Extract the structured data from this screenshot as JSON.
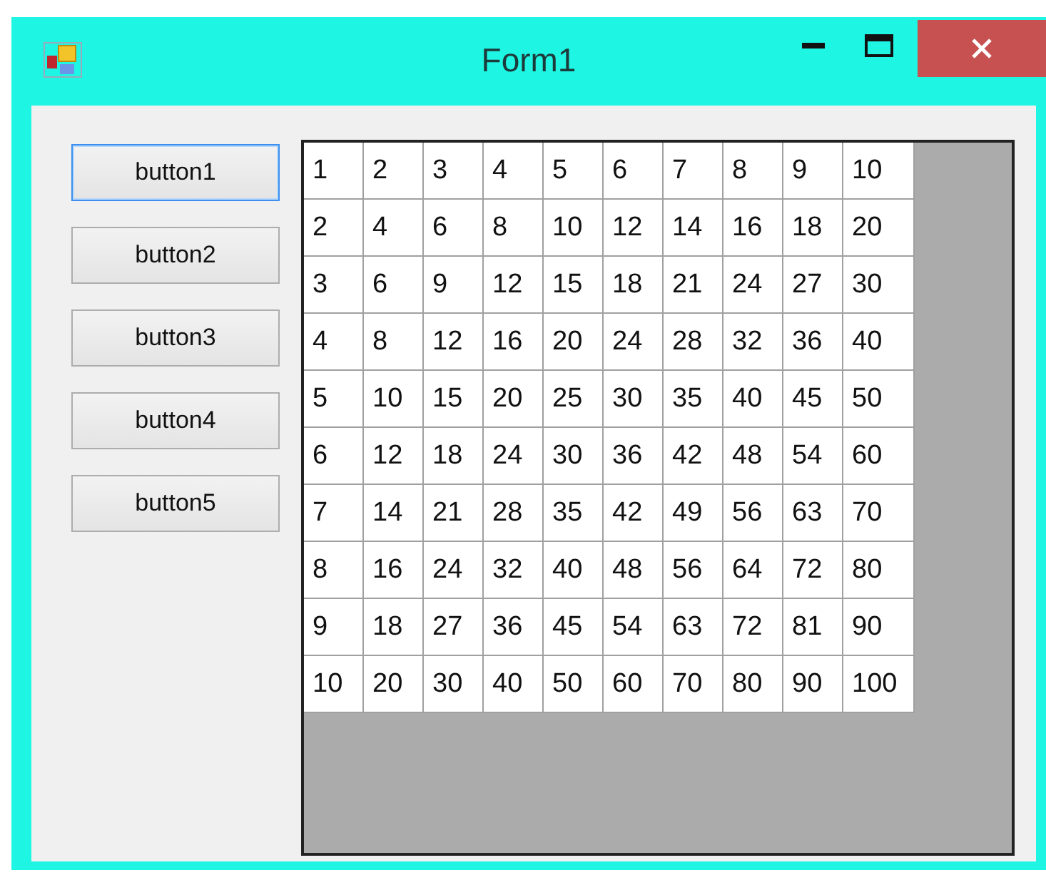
{
  "window": {
    "title": "Form1"
  },
  "buttons": [
    {
      "label": "button1",
      "focused": true
    },
    {
      "label": "button2",
      "focused": false
    },
    {
      "label": "button3",
      "focused": false
    },
    {
      "label": "button4",
      "focused": false
    },
    {
      "label": "button5",
      "focused": false
    }
  ],
  "table": {
    "rows": [
      [
        "1",
        "2",
        "3",
        "4",
        "5",
        "6",
        "7",
        "8",
        "9",
        "10"
      ],
      [
        "2",
        "4",
        "6",
        "8",
        "10",
        "12",
        "14",
        "16",
        "18",
        "20"
      ],
      [
        "3",
        "6",
        "9",
        "12",
        "15",
        "18",
        "21",
        "24",
        "27",
        "30"
      ],
      [
        "4",
        "8",
        "12",
        "16",
        "20",
        "24",
        "28",
        "32",
        "36",
        "40"
      ],
      [
        "5",
        "10",
        "15",
        "20",
        "25",
        "30",
        "35",
        "40",
        "45",
        "50"
      ],
      [
        "6",
        "12",
        "18",
        "24",
        "30",
        "36",
        "42",
        "48",
        "54",
        "60"
      ],
      [
        "7",
        "14",
        "21",
        "28",
        "35",
        "42",
        "49",
        "56",
        "63",
        "70"
      ],
      [
        "8",
        "16",
        "24",
        "32",
        "40",
        "48",
        "56",
        "64",
        "72",
        "80"
      ],
      [
        "9",
        "18",
        "27",
        "36",
        "45",
        "54",
        "63",
        "72",
        "81",
        "90"
      ],
      [
        "10",
        "20",
        "30",
        "40",
        "50",
        "60",
        "70",
        "80",
        "90",
        "100"
      ]
    ]
  }
}
